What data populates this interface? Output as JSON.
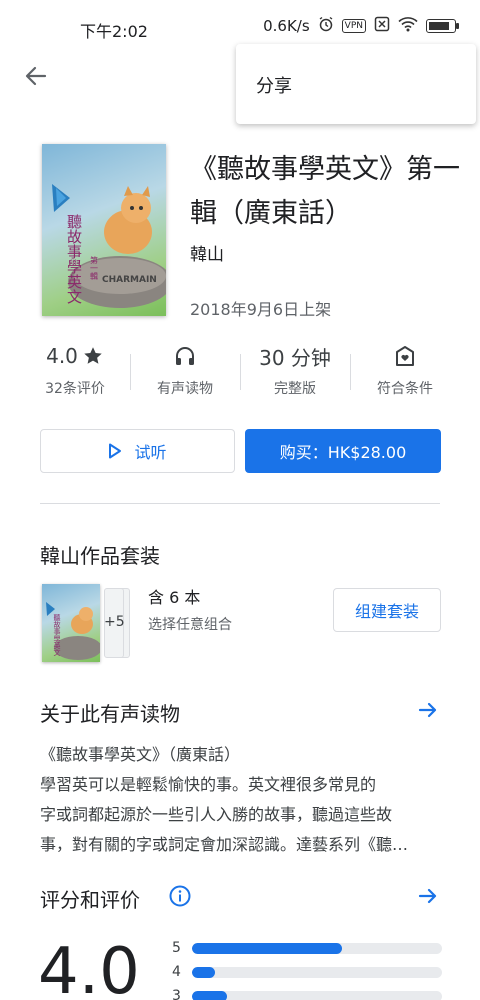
{
  "status_bar": {
    "time": "下午2:02",
    "network_speed": "0.6K/s",
    "vpn_label": "VPN",
    "battery_level": 0.85
  },
  "menu": {
    "share_label": "分享"
  },
  "book": {
    "title": "《聽故事學英文》第一輯（廣東話）",
    "author": "韓山",
    "release_date": "2018年9月6日上架",
    "cover_lines": [
      "聽故事學英文",
      "第一輯"
    ],
    "cover_publisher": "CHARMAIN"
  },
  "stats": [
    {
      "top": "4.0",
      "top_icon": "star-icon",
      "bottom": "32条评价"
    },
    {
      "top_icon": "headphones-icon",
      "bottom": "有声读物"
    },
    {
      "top": "30 分钟",
      "bottom": "完整版"
    },
    {
      "top_icon": "family-house-icon",
      "bottom": "符合条件"
    }
  ],
  "actions": {
    "preview_label": "试听",
    "buy_label": "购买：HK$28.00"
  },
  "bundle": {
    "heading": "韓山作品套装",
    "count": "含 6 本",
    "subtitle": "选择任意组合",
    "stack_count": "+5",
    "button_label": "组建套装"
  },
  "about": {
    "heading": "关于此有声读物",
    "lines": [
      "《聽故事學英文》（廣東話）",
      "學習英可以是輕鬆愉快的事。英文裡很多常見的",
      "字或詞都起源於一些引人入勝的故事，聽過這些故",
      "事，對有關的字或詞定會加深認識。達藝系列《聽…"
    ]
  },
  "ratings": {
    "heading": "评分和评价",
    "average": "4.0",
    "distribution": [
      {
        "stars": "5",
        "fraction": 0.6
      },
      {
        "stars": "4",
        "fraction": 0.09
      },
      {
        "stars": "3",
        "fraction": 0.14
      }
    ]
  },
  "colors": {
    "accent": "#1a73e8",
    "text_primary": "#202124",
    "text_secondary": "#5f6368",
    "divider": "#dadce0"
  }
}
